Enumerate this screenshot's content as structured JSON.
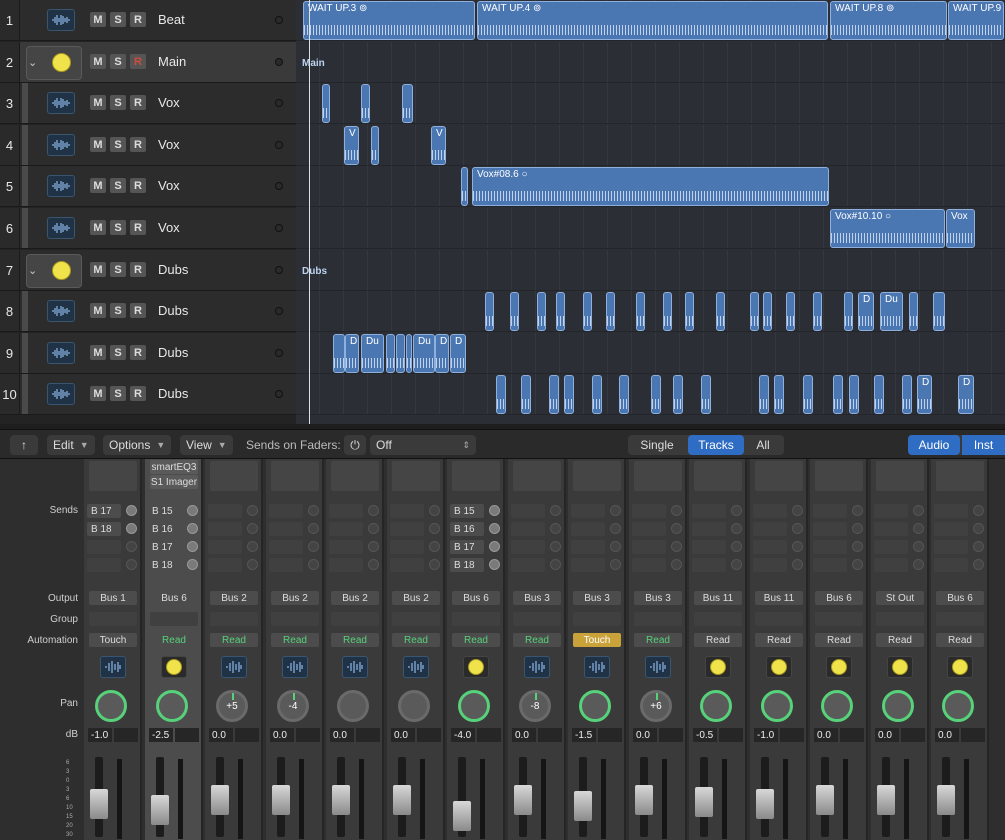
{
  "tracks": [
    {
      "num": "1",
      "name": "Beat",
      "kind": "audio",
      "rec": false
    },
    {
      "num": "2",
      "name": "Main",
      "kind": "stack",
      "rec": true
    },
    {
      "num": "3",
      "name": "Vox",
      "kind": "audio",
      "rec": false
    },
    {
      "num": "4",
      "name": "Vox",
      "kind": "audio",
      "rec": false
    },
    {
      "num": "5",
      "name": "Vox",
      "kind": "audio",
      "rec": false
    },
    {
      "num": "6",
      "name": "Vox",
      "kind": "audio",
      "rec": false
    },
    {
      "num": "7",
      "name": "Dubs",
      "kind": "stack",
      "rec": false
    },
    {
      "num": "8",
      "name": "Dubs",
      "kind": "audio",
      "rec": false
    },
    {
      "num": "9",
      "name": "Dubs",
      "kind": "audio",
      "rec": false
    },
    {
      "num": "10",
      "name": "Dubs",
      "kind": "audio",
      "rec": false
    }
  ],
  "track_buttons": {
    "mute": "M",
    "solo": "S",
    "record": "R"
  },
  "regions": {
    "beat": [
      "WAIT UP.3",
      "WAIT UP.4",
      "WAIT UP.8",
      "WAIT UP.9"
    ],
    "main_folder": "Main",
    "dubs_folder": "Dubs",
    "vox4": [
      "V",
      "V"
    ],
    "vox5": "Vox#08.6",
    "vox6": [
      "Vox#10.10",
      "Vox"
    ],
    "dubs8": [
      "D",
      "Du"
    ],
    "dubs9": [
      "D",
      "Du",
      "Du",
      "D",
      "D"
    ],
    "dubs10": [
      "D",
      "D"
    ]
  },
  "toolbar": {
    "edit": "Edit",
    "options": "Options",
    "view": "View",
    "sends_on_faders": "Sends on Faders:",
    "sends_value": "Off",
    "single": "Single",
    "tracks": "Tracks",
    "all": "All",
    "audio": "Audio",
    "inst": "Inst"
  },
  "mixer_labels": {
    "sends": "Sends",
    "output": "Output",
    "group": "Group",
    "automation": "Automation",
    "pan": "Pan",
    "db": "dB"
  },
  "plugins": [
    "smartEQ3",
    "S1 Imager"
  ],
  "sends": {
    "strip1": [
      "B 17",
      "B 18"
    ],
    "strip2": [
      "B 15",
      "B 16",
      "B 17",
      "B 18"
    ],
    "strip7": [
      "B 15",
      "B 16",
      "B 17",
      "B 18"
    ]
  },
  "strips": [
    {
      "output": "Bus 1",
      "automation": "Touch",
      "pan": "",
      "db": "-1.0",
      "icon": "audio"
    },
    {
      "output": "Bus 6",
      "automation": "Read",
      "pan": "",
      "db": "-2.5",
      "icon": "stack"
    },
    {
      "output": "Bus 2",
      "automation": "Read",
      "pan": "+5",
      "db": "0.0",
      "icon": "audio"
    },
    {
      "output": "Bus 2",
      "automation": "Read",
      "pan": "-4",
      "db": "0.0",
      "icon": "audio"
    },
    {
      "output": "Bus 2",
      "automation": "Read",
      "pan": "",
      "db": "0.0",
      "icon": "audio"
    },
    {
      "output": "Bus 2",
      "automation": "Read",
      "pan": "",
      "db": "0.0",
      "icon": "audio"
    },
    {
      "output": "Bus 6",
      "automation": "Read",
      "pan": "",
      "db": "-4.0",
      "icon": "stack"
    },
    {
      "output": "Bus 3",
      "automation": "Read",
      "pan": "-8",
      "db": "0.0",
      "icon": "audio"
    },
    {
      "output": "Bus 3",
      "automation": "Touch",
      "pan": "",
      "db": "-1.5",
      "icon": "audio"
    },
    {
      "output": "Bus 3",
      "automation": "Read",
      "pan": "+6",
      "db": "0.0",
      "icon": "audio"
    },
    {
      "output": "Bus 11",
      "automation": "Read",
      "pan": "",
      "db": "-0.5",
      "icon": "stack"
    },
    {
      "output": "Bus 11",
      "automation": "Read",
      "pan": "",
      "db": "-1.0",
      "icon": "stack"
    },
    {
      "output": "Bus 6",
      "automation": "Read",
      "pan": "",
      "db": "0.0",
      "icon": "stack"
    },
    {
      "output": "St Out",
      "automation": "Read",
      "pan": "",
      "db": "0.0",
      "icon": "stack"
    },
    {
      "output": "Bus 6",
      "automation": "Read",
      "pan": "",
      "db": "0.0",
      "icon": "stack"
    }
  ],
  "fader_scale": [
    "6",
    "3",
    "0",
    "3",
    "6",
    "10",
    "15",
    "20",
    "30"
  ],
  "meter_scale": [
    "0",
    "3",
    "6",
    "9",
    "12",
    "15",
    "18",
    "21",
    "24",
    "30"
  ],
  "colors": {
    "read": "#57d17a",
    "touch": "#c9a23a",
    "region": "#4a76b2",
    "accent": "#2f6cc3",
    "stack_icon": "#f0e24a"
  }
}
